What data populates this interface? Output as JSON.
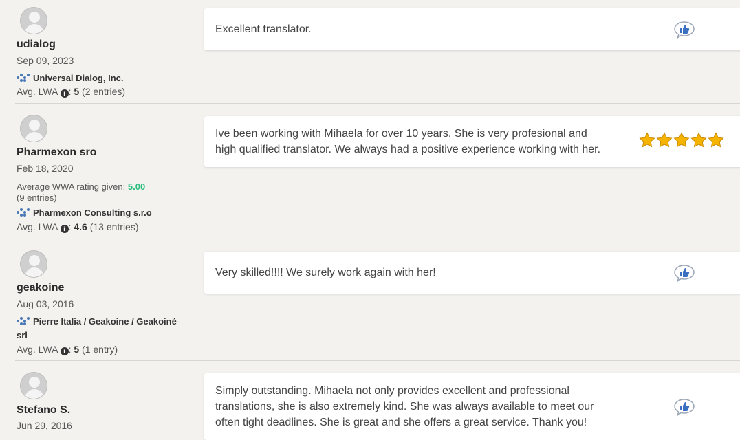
{
  "reviews": [
    {
      "username": "udialog",
      "date": "Sep 09, 2023",
      "company": "Universal Dialog, Inc.",
      "lwa_label": "Avg. LWA",
      "lwa_value": "5",
      "lwa_entries": "(2 entries)",
      "comment": "Excellent translator.",
      "rating_stars": null,
      "icon": "thumbs-up-bubble-icon"
    },
    {
      "username": "Pharmexon sro",
      "date": "Feb 18, 2020",
      "wwa_label": "Average WWA rating given:",
      "wwa_value": "5.00",
      "wwa_entries": "(9 entries)",
      "company": "Pharmexon Consulting s.r.o",
      "lwa_label": "Avg. LWA",
      "lwa_value": "4.6",
      "lwa_entries": "(13 entries)",
      "comment_line1": "Ive been working with Mihaela for over 10 years. She is very profesional and",
      "comment_line2": "high qualified translator. We always had a positive experience working with her.",
      "rating_stars": 5,
      "icon": "star-icon"
    },
    {
      "username": "geakoine",
      "date": "Aug 03, 2016",
      "company_line1": "Pierre Italia / Geakoine / Geakoiné",
      "company_line2": "srl",
      "lwa_label": "Avg. LWA",
      "lwa_value": "5",
      "lwa_entries": "(1 entry)",
      "comment": "Very skilled!!!! We surely work again with her!",
      "rating_stars": null,
      "icon": "thumbs-up-bubble-icon"
    },
    {
      "username": "Stefano S.",
      "date": "Jun 29, 2016",
      "comment_line1": "Simply outstanding. Mihaela not only provides excellent and professional",
      "comment_line2": "translations, she is also extremely kind. She was always available to meet our",
      "comment_line3": "often tight deadlines. She is great and she offers a great service. Thank you!",
      "rating_stars": null,
      "icon": "thumbs-up-bubble-icon"
    }
  ],
  "colors": {
    "background": "#f3f2ee",
    "card": "#ffffff",
    "wwa_green": "#2bbf7f",
    "icon_blue": "#3b6fc0",
    "star_gold": "#f5b400"
  }
}
